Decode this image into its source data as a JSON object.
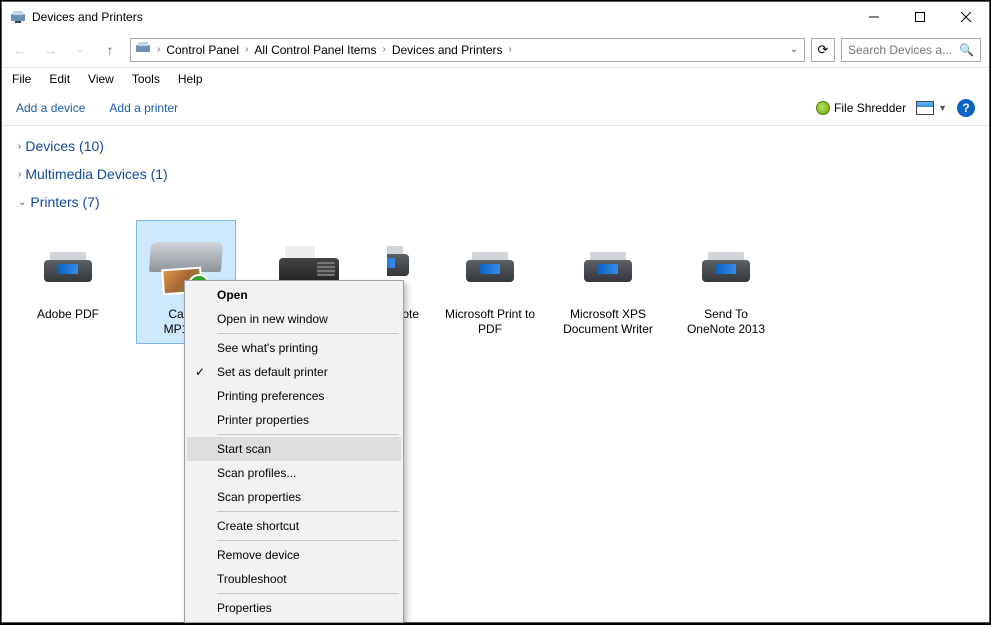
{
  "window": {
    "title": "Devices and Printers"
  },
  "breadcrumbs": [
    "Control Panel",
    "All Control Panel Items",
    "Devices and Printers"
  ],
  "search": {
    "placeholder": "Search Devices a..."
  },
  "menubar": [
    "File",
    "Edit",
    "View",
    "Tools",
    "Help"
  ],
  "toolbar": {
    "add_device": "Add a device",
    "add_printer": "Add a printer",
    "file_shredder": "File Shredder"
  },
  "groups": {
    "devices": {
      "label": "Devices (10)",
      "expanded": false
    },
    "multimedia": {
      "label": "Multimedia Devices (1)",
      "expanded": false
    },
    "printers": {
      "label": "Printers (7)",
      "expanded": true
    }
  },
  "printers": [
    {
      "name": "Adobe PDF",
      "icon": "printer",
      "selected": false
    },
    {
      "name": "Canon MP160 [...]",
      "icon": "scanner",
      "selected": true,
      "default": true
    },
    {
      "name": "",
      "icon": "fax",
      "selected": false,
      "partial_label": "ote"
    },
    {
      "name": "Microsoft Print to PDF",
      "icon": "printer",
      "selected": false
    },
    {
      "name": "Microsoft XPS Document Writer",
      "icon": "printer",
      "selected": false
    },
    {
      "name": "Send To OneNote 2013",
      "icon": "printer",
      "selected": false
    }
  ],
  "context_menu": [
    {
      "label": "Open",
      "bold": true
    },
    {
      "label": "Open in new window"
    },
    {
      "sep": true
    },
    {
      "label": "See what's printing"
    },
    {
      "label": "Set as default printer",
      "check": true
    },
    {
      "label": "Printing preferences"
    },
    {
      "label": "Printer properties"
    },
    {
      "sep": true
    },
    {
      "label": "Start scan",
      "highlighted": true
    },
    {
      "label": "Scan profiles..."
    },
    {
      "label": "Scan properties",
      "shield": true
    },
    {
      "sep": true
    },
    {
      "label": "Create shortcut"
    },
    {
      "sep": true
    },
    {
      "label": "Remove device",
      "shield": true
    },
    {
      "label": "Troubleshoot"
    },
    {
      "sep": true
    },
    {
      "label": "Properties"
    }
  ]
}
